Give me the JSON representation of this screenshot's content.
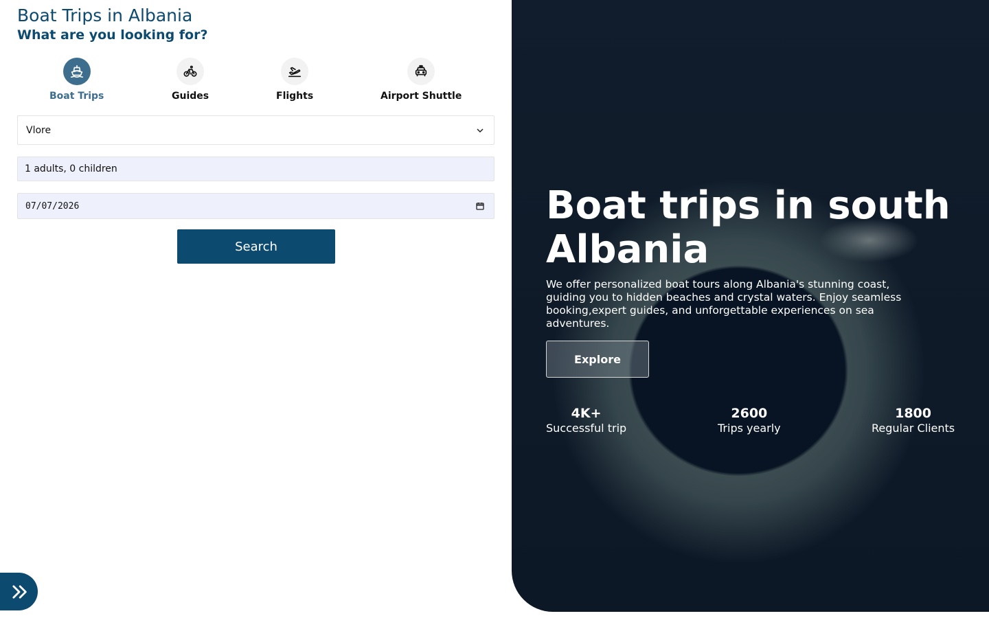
{
  "header": {
    "title": "Boat Trips in Albania",
    "subtitle": "What are you looking for?"
  },
  "categories": [
    {
      "label": "Boat Trips",
      "icon": "ship-icon",
      "active": true
    },
    {
      "label": "Guides",
      "icon": "bicycle-icon",
      "active": false
    },
    {
      "label": "Flights",
      "icon": "airplane-icon",
      "active": false
    },
    {
      "label": "Airport Shuttle",
      "icon": "car-icon",
      "active": false
    }
  ],
  "form": {
    "location_value": "Vlore",
    "guests_value": "1 adults, 0 children",
    "date_value": "07/07/2026",
    "search_label": "Search"
  },
  "hero": {
    "title": "Boat trips in south Albania",
    "description": "We offer personalized boat tours along Albania's stunning coast, guiding you to hidden beaches and crystal waters. Enjoy seamless booking,expert guides, and unforgettable experiences on sea adventures.",
    "explore_label": "Explore",
    "stats": [
      {
        "value": "4K+",
        "caption": "Successful trip"
      },
      {
        "value": "2600",
        "caption": "Trips yearly"
      },
      {
        "value": "1800",
        "caption": "Regular Clients"
      }
    ]
  },
  "colors": {
    "brand": "#0d4a6f",
    "active_category": "#3e6e8d",
    "input_bg": "#eef0fb"
  }
}
